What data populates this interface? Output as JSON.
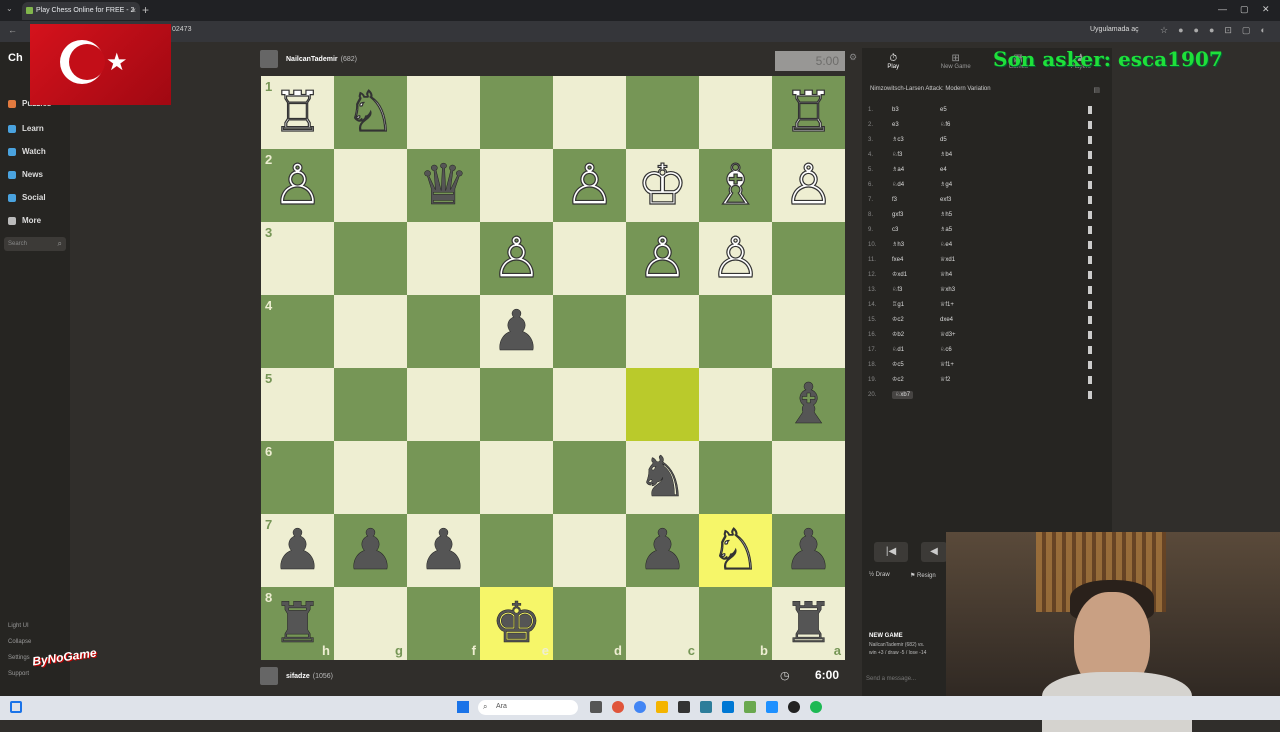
{
  "browser": {
    "tab_title": "Play Chess Online for FREE - 2",
    "tab_close": "×",
    "new_tab": "+",
    "url_fragment": "02473",
    "open_in_app": "Uygulamada aç",
    "win_min": "—",
    "win_max": "▢",
    "win_close": "✕"
  },
  "sidebar": {
    "logo": "Ch",
    "items": [
      {
        "label": "Puzzles",
        "color": "#e27a3f"
      },
      {
        "label": "Learn",
        "color": "#4aa3df"
      },
      {
        "label": "Watch",
        "color": "#4aa3df"
      },
      {
        "label": "News",
        "color": "#4aa3df"
      },
      {
        "label": "Social",
        "color": "#4aa3df"
      },
      {
        "label": "More",
        "color": "#bbbbbb"
      }
    ],
    "search_placeholder": "Search",
    "bottom": [
      "Light UI",
      "Collapse",
      "Settings",
      "Support"
    ]
  },
  "top_player": {
    "name": "NailcanTademir",
    "rating": "(682)",
    "clock": "5:00"
  },
  "bottom_player": {
    "name": "sifadze",
    "rating": "(1056)",
    "clock": "6:00"
  },
  "board": {
    "ranks": [
      "1",
      "2",
      "3",
      "4",
      "5",
      "6",
      "7",
      "8"
    ],
    "files": [
      "h",
      "g",
      "f",
      "e",
      "d",
      "c",
      "b",
      "a"
    ],
    "squares": [
      [
        "wR",
        "wN",
        "",
        "",
        "",
        "",
        "",
        "wR"
      ],
      [
        "wP",
        "",
        "bQ",
        "",
        "wP",
        "wK",
        "wB",
        "wP"
      ],
      [
        "",
        "",
        "",
        "wP",
        "",
        "wP",
        "wP",
        ""
      ],
      [
        "",
        "",
        "",
        "bP",
        "",
        "",
        "",
        ""
      ],
      [
        "",
        "",
        "",
        "",
        "",
        "",
        "",
        "bB"
      ],
      [
        "",
        "",
        "",
        "",
        "",
        "bN",
        "",
        ""
      ],
      [
        "bP",
        "bP",
        "bP",
        "",
        "",
        "bP",
        "wN",
        "bP"
      ],
      [
        "bR",
        "",
        "",
        "bK",
        "",
        "",
        "",
        "bR"
      ]
    ],
    "highlights": [
      [
        4,
        5
      ],
      [
        6,
        6
      ],
      [
        7,
        3
      ]
    ]
  },
  "panel": {
    "tabs": [
      {
        "label": "Play",
        "icon": "⏱"
      },
      {
        "label": "New Game",
        "icon": "⊞"
      },
      {
        "label": "Games",
        "icon": "▦"
      },
      {
        "label": "Players",
        "icon": "♟"
      }
    ],
    "opening": "Nimzowitsch-Larsen Attack: Modern Variation",
    "moves": [
      {
        "n": "1.",
        "w": "b3",
        "b": "e5"
      },
      {
        "n": "2.",
        "w": "e3",
        "b": "♘f6"
      },
      {
        "n": "3.",
        "w": "♗c3",
        "b": "d5"
      },
      {
        "n": "4.",
        "w": "♘f3",
        "b": "♗b4"
      },
      {
        "n": "5.",
        "w": "♗a4",
        "b": "e4"
      },
      {
        "n": "6.",
        "w": "♘d4",
        "b": "♗g4"
      },
      {
        "n": "7.",
        "w": "f3",
        "b": "exf3"
      },
      {
        "n": "8.",
        "w": "gxf3",
        "b": "♗h5"
      },
      {
        "n": "9.",
        "w": "c3",
        "b": "♗a5"
      },
      {
        "n": "10.",
        "w": "♗h3",
        "b": "♘e4"
      },
      {
        "n": "11.",
        "w": "fxe4",
        "b": "♕xd1"
      },
      {
        "n": "12.",
        "w": "♔xd1",
        "b": "♕h4"
      },
      {
        "n": "13.",
        "w": "♘f3",
        "b": "♕xh3"
      },
      {
        "n": "14.",
        "w": "♖g1",
        "b": "♕f1+"
      },
      {
        "n": "15.",
        "w": "♔c2",
        "b": "dxe4"
      },
      {
        "n": "16.",
        "w": "♔b2",
        "b": "♕d3+"
      },
      {
        "n": "17.",
        "w": "♘d1",
        "b": "♘c6"
      },
      {
        "n": "18.",
        "w": "♔c5",
        "b": "♕f1+"
      },
      {
        "n": "19.",
        "w": "♔c2",
        "b": "♕f2"
      },
      {
        "n": "20.",
        "w": "♘xb7",
        "b": ""
      }
    ],
    "draw": "Draw",
    "resign": "Resign",
    "first_btn": "|◀",
    "prev_btn": "◀",
    "new_game": "NEW GAME",
    "game_summary": "NailcanTademir (682) vs.",
    "game_summary2": "win +3 / draw -5 / lose -14",
    "send_message": "Send a message..."
  },
  "overlay": {
    "text": "Son asker: esca1907",
    "watermark": "ByNoGame"
  },
  "taskbar": {
    "search": "Ara"
  }
}
